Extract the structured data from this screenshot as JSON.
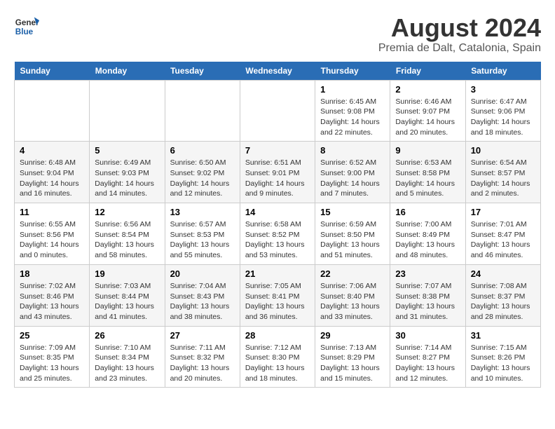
{
  "logo": {
    "general": "General",
    "blue": "Blue"
  },
  "title": "August 2024",
  "subtitle": "Premia de Dalt, Catalonia, Spain",
  "headers": [
    "Sunday",
    "Monday",
    "Tuesday",
    "Wednesday",
    "Thursday",
    "Friday",
    "Saturday"
  ],
  "weeks": [
    [
      {
        "day": "",
        "info": ""
      },
      {
        "day": "",
        "info": ""
      },
      {
        "day": "",
        "info": ""
      },
      {
        "day": "",
        "info": ""
      },
      {
        "day": "1",
        "info": "Sunrise: 6:45 AM\nSunset: 9:08 PM\nDaylight: 14 hours and 22 minutes."
      },
      {
        "day": "2",
        "info": "Sunrise: 6:46 AM\nSunset: 9:07 PM\nDaylight: 14 hours and 20 minutes."
      },
      {
        "day": "3",
        "info": "Sunrise: 6:47 AM\nSunset: 9:06 PM\nDaylight: 14 hours and 18 minutes."
      }
    ],
    [
      {
        "day": "4",
        "info": "Sunrise: 6:48 AM\nSunset: 9:04 PM\nDaylight: 14 hours and 16 minutes."
      },
      {
        "day": "5",
        "info": "Sunrise: 6:49 AM\nSunset: 9:03 PM\nDaylight: 14 hours and 14 minutes."
      },
      {
        "day": "6",
        "info": "Sunrise: 6:50 AM\nSunset: 9:02 PM\nDaylight: 14 hours and 12 minutes."
      },
      {
        "day": "7",
        "info": "Sunrise: 6:51 AM\nSunset: 9:01 PM\nDaylight: 14 hours and 9 minutes."
      },
      {
        "day": "8",
        "info": "Sunrise: 6:52 AM\nSunset: 9:00 PM\nDaylight: 14 hours and 7 minutes."
      },
      {
        "day": "9",
        "info": "Sunrise: 6:53 AM\nSunset: 8:58 PM\nDaylight: 14 hours and 5 minutes."
      },
      {
        "day": "10",
        "info": "Sunrise: 6:54 AM\nSunset: 8:57 PM\nDaylight: 14 hours and 2 minutes."
      }
    ],
    [
      {
        "day": "11",
        "info": "Sunrise: 6:55 AM\nSunset: 8:56 PM\nDaylight: 14 hours and 0 minutes."
      },
      {
        "day": "12",
        "info": "Sunrise: 6:56 AM\nSunset: 8:54 PM\nDaylight: 13 hours and 58 minutes."
      },
      {
        "day": "13",
        "info": "Sunrise: 6:57 AM\nSunset: 8:53 PM\nDaylight: 13 hours and 55 minutes."
      },
      {
        "day": "14",
        "info": "Sunrise: 6:58 AM\nSunset: 8:52 PM\nDaylight: 13 hours and 53 minutes."
      },
      {
        "day": "15",
        "info": "Sunrise: 6:59 AM\nSunset: 8:50 PM\nDaylight: 13 hours and 51 minutes."
      },
      {
        "day": "16",
        "info": "Sunrise: 7:00 AM\nSunset: 8:49 PM\nDaylight: 13 hours and 48 minutes."
      },
      {
        "day": "17",
        "info": "Sunrise: 7:01 AM\nSunset: 8:47 PM\nDaylight: 13 hours and 46 minutes."
      }
    ],
    [
      {
        "day": "18",
        "info": "Sunrise: 7:02 AM\nSunset: 8:46 PM\nDaylight: 13 hours and 43 minutes."
      },
      {
        "day": "19",
        "info": "Sunrise: 7:03 AM\nSunset: 8:44 PM\nDaylight: 13 hours and 41 minutes."
      },
      {
        "day": "20",
        "info": "Sunrise: 7:04 AM\nSunset: 8:43 PM\nDaylight: 13 hours and 38 minutes."
      },
      {
        "day": "21",
        "info": "Sunrise: 7:05 AM\nSunset: 8:41 PM\nDaylight: 13 hours and 36 minutes."
      },
      {
        "day": "22",
        "info": "Sunrise: 7:06 AM\nSunset: 8:40 PM\nDaylight: 13 hours and 33 minutes."
      },
      {
        "day": "23",
        "info": "Sunrise: 7:07 AM\nSunset: 8:38 PM\nDaylight: 13 hours and 31 minutes."
      },
      {
        "day": "24",
        "info": "Sunrise: 7:08 AM\nSunset: 8:37 PM\nDaylight: 13 hours and 28 minutes."
      }
    ],
    [
      {
        "day": "25",
        "info": "Sunrise: 7:09 AM\nSunset: 8:35 PM\nDaylight: 13 hours and 25 minutes."
      },
      {
        "day": "26",
        "info": "Sunrise: 7:10 AM\nSunset: 8:34 PM\nDaylight: 13 hours and 23 minutes."
      },
      {
        "day": "27",
        "info": "Sunrise: 7:11 AM\nSunset: 8:32 PM\nDaylight: 13 hours and 20 minutes."
      },
      {
        "day": "28",
        "info": "Sunrise: 7:12 AM\nSunset: 8:30 PM\nDaylight: 13 hours and 18 minutes."
      },
      {
        "day": "29",
        "info": "Sunrise: 7:13 AM\nSunset: 8:29 PM\nDaylight: 13 hours and 15 minutes."
      },
      {
        "day": "30",
        "info": "Sunrise: 7:14 AM\nSunset: 8:27 PM\nDaylight: 13 hours and 12 minutes."
      },
      {
        "day": "31",
        "info": "Sunrise: 7:15 AM\nSunset: 8:26 PM\nDaylight: 13 hours and 10 minutes."
      }
    ]
  ]
}
